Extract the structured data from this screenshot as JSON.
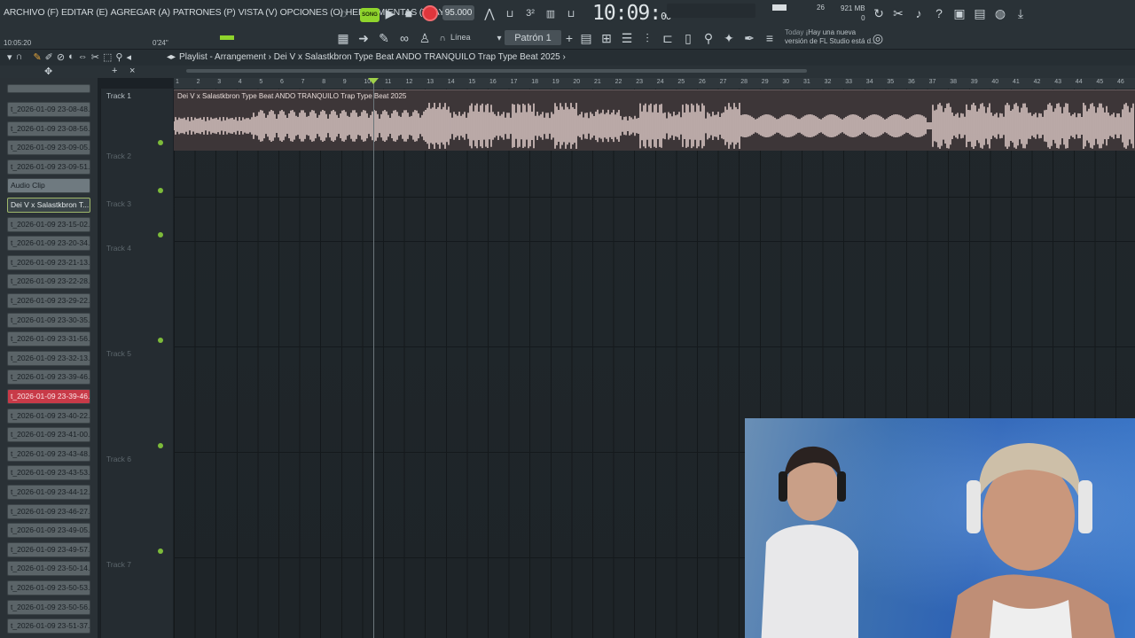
{
  "menu": {
    "items": [
      "ARCHIVO (F)",
      "EDITAR (E)",
      "AGREGAR (A)",
      "PATRONES (P)",
      "VISTA (V)",
      "OPCIONES (O)",
      "HERRAMIENTAS (T)",
      "AYUDA"
    ]
  },
  "transport": {
    "small_time": "10:05:20",
    "small_duration": "0'24\"",
    "song_label": "SONG",
    "tempo": "95.000",
    "big_time": "10:09",
    "big_time_sub": "00",
    "cpu": "26",
    "mem_mb": "921 MB",
    "mem_zero": "0",
    "snap_label": "Línea",
    "pattern": "Patrón 1",
    "news_today": "Today",
    "news_line1": "¡Hay una nueva",
    "news_line2": "versión de FL Studio está d..."
  },
  "playlist": {
    "title": "Playlist - Arrangement › Dei V x Salastkbron Type Beat  ANDO TRANQUILO  Trap Type Beat 2025 ›",
    "clip_title": "Dei V x Salastkbron Type Beat  ANDO TRANQUILO  Trap Type Beat 2025",
    "ruler": [
      "1",
      "2",
      "3",
      "4",
      "5",
      "6",
      "7",
      "8",
      "9",
      "10",
      "11",
      "12",
      "13",
      "14",
      "15",
      "16",
      "17",
      "18",
      "19",
      "20",
      "21",
      "22",
      "23",
      "24",
      "25",
      "26",
      "27",
      "28",
      "29",
      "30",
      "31",
      "32",
      "33",
      "34",
      "35",
      "36",
      "37",
      "38",
      "39",
      "40",
      "41",
      "42",
      "43",
      "44",
      "45",
      "46"
    ],
    "tracks": [
      "Track 1",
      "Track 2",
      "Track 3",
      "Track 4",
      "Track 5",
      "Track 6",
      "Track 7"
    ]
  },
  "browser": {
    "items": [
      {
        "label": "t_2026-01-09 23-08-48...",
        "style": "normal"
      },
      {
        "label": "t_2026-01-09 23-08-56...",
        "style": "normal"
      },
      {
        "label": "t_2026-01-09 23-09-05...",
        "style": "normal"
      },
      {
        "label": "t_2026-01-09 23-09-51...",
        "style": "normal"
      },
      {
        "label": "Audio Clip",
        "style": "label"
      },
      {
        "label": "Dei V x Salastkbron T...",
        "style": "sel"
      },
      {
        "label": "t_2026-01-09 23-15-02...",
        "style": "normal"
      },
      {
        "label": "t_2026-01-09 23-20-34...",
        "style": "normal"
      },
      {
        "label": "t_2026-01-09 23-21-13...",
        "style": "normal"
      },
      {
        "label": "t_2026-01-09 23-22-28...",
        "style": "normal"
      },
      {
        "label": "t_2026-01-09 23-29-22...",
        "style": "normal"
      },
      {
        "label": "t_2026-01-09 23-30-35...",
        "style": "normal"
      },
      {
        "label": "t_2026-01-09 23-31-56...",
        "style": "normal"
      },
      {
        "label": "t_2026-01-09 23-32-13...",
        "style": "normal"
      },
      {
        "label": "t_2026-01-09 23-39-46...",
        "style": "normal"
      },
      {
        "label": "t_2026-01-09 23-39-46...",
        "style": "red"
      },
      {
        "label": "t_2026-01-09 23-40-22...",
        "style": "normal"
      },
      {
        "label": "t_2026-01-09 23-41-00...",
        "style": "normal"
      },
      {
        "label": "t_2026-01-09 23-43-48...",
        "style": "normal"
      },
      {
        "label": "t_2026-01-09 23-43-53...",
        "style": "normal"
      },
      {
        "label": "t_2026-01-09 23-44-12...",
        "style": "normal"
      },
      {
        "label": "t_2026-01-09 23-46-27...",
        "style": "normal"
      },
      {
        "label": "t_2026-01-09 23-49-05...",
        "style": "normal"
      },
      {
        "label": "t_2026-01-09 23-49-57...",
        "style": "normal"
      },
      {
        "label": "t_2026-01-09 23-50-14...",
        "style": "normal"
      },
      {
        "label": "t_2026-01-09 23-50-53...",
        "style": "normal"
      },
      {
        "label": "t_2026-01-09 23-50-56...",
        "style": "normal"
      },
      {
        "label": "t_2026-01-09 23-51-37...",
        "style": "normal"
      }
    ]
  },
  "colors": {
    "accent_green": "#8fd42c",
    "record_red": "#e0363c",
    "clip_red": "#c83a48",
    "waveform": "#d9c6c3"
  }
}
